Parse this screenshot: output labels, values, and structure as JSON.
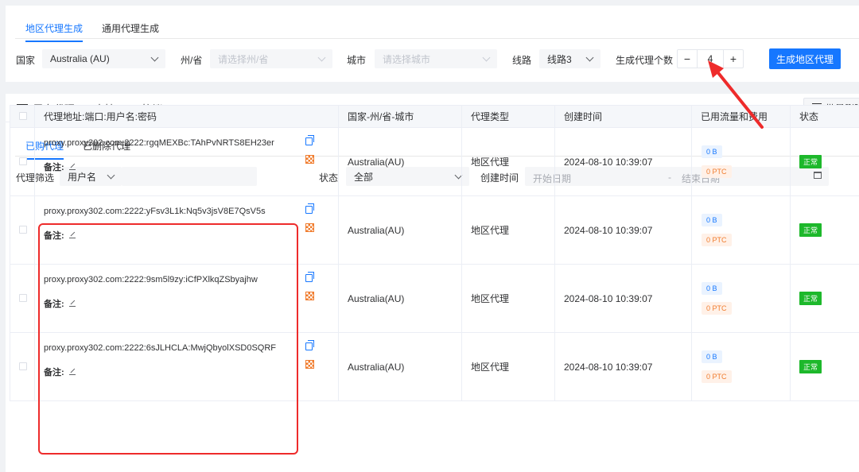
{
  "top_tabs": [
    {
      "label": "地区代理生成",
      "active": true
    },
    {
      "label": "通用代理生成",
      "active": false
    }
  ],
  "form": {
    "country_label": "国家",
    "country_value": "Australia (AU)",
    "state_label": "州/省",
    "state_placeholder": "请选择州/省",
    "city_label": "城市",
    "city_placeholder": "请选择城市",
    "line_label": "线路",
    "line_value": "线路3",
    "count_label": "生成代理个数",
    "count_value": "4",
    "minus": "−",
    "plus": "+",
    "generate_button": "生成地区代理"
  },
  "list": {
    "title": "已有代理 ( 只支持HTTP协议 )",
    "batch_delete": "批量删除",
    "tabs": [
      {
        "label": "已购代理",
        "active": true
      },
      {
        "label": "已删除代理",
        "active": false
      }
    ],
    "filter_label": "代理筛选",
    "filter_field": "用户名",
    "status_label": "状态",
    "status_value": "全部",
    "created_label": "创建时间",
    "start_placeholder": "开始日期",
    "range_sep": "-",
    "end_placeholder": "结束日期",
    "columns": [
      "代理地址:端口:用户名:密码",
      "国家-州/省-城市",
      "代理类型",
      "创建时间",
      "已用流量和费用",
      "状态"
    ],
    "note_label": "备注:",
    "rows": [
      {
        "address": "proxy.proxy302.com:2222:rgqMEXBc:TAhPvNRTS8EH23er",
        "region": "Australia(AU)",
        "type": "地区代理",
        "created": "2024-08-10 10:39:07",
        "traffic": "0 B",
        "cost": "0 PTC",
        "status": "正常"
      },
      {
        "address": "proxy.proxy302.com:2222:yFsv3L1k:Nq5v3jsV8E7QsV5s",
        "region": "Australia(AU)",
        "type": "地区代理",
        "created": "2024-08-10 10:39:07",
        "traffic": "0 B",
        "cost": "0 PTC",
        "status": "正常"
      },
      {
        "address": "proxy.proxy302.com:2222:9sm5l9zy:iCfPXlkqZSbyajhw",
        "region": "Australia(AU)",
        "type": "地区代理",
        "created": "2024-08-10 10:39:07",
        "traffic": "0 B",
        "cost": "0 PTC",
        "status": "正常"
      },
      {
        "address": "proxy.proxy302.com:2222:6sJLHCLA:MwjQbyolXSD0SQRF",
        "region": "Australia(AU)",
        "type": "地区代理",
        "created": "2024-08-10 10:39:07",
        "traffic": "0 B",
        "cost": "0 PTC",
        "status": "正常"
      }
    ]
  },
  "colors": {
    "primary": "#1677ff",
    "annotation_red": "#ee2b2b",
    "status_green": "#1db82b",
    "cost_orange": "#f07c2e"
  }
}
